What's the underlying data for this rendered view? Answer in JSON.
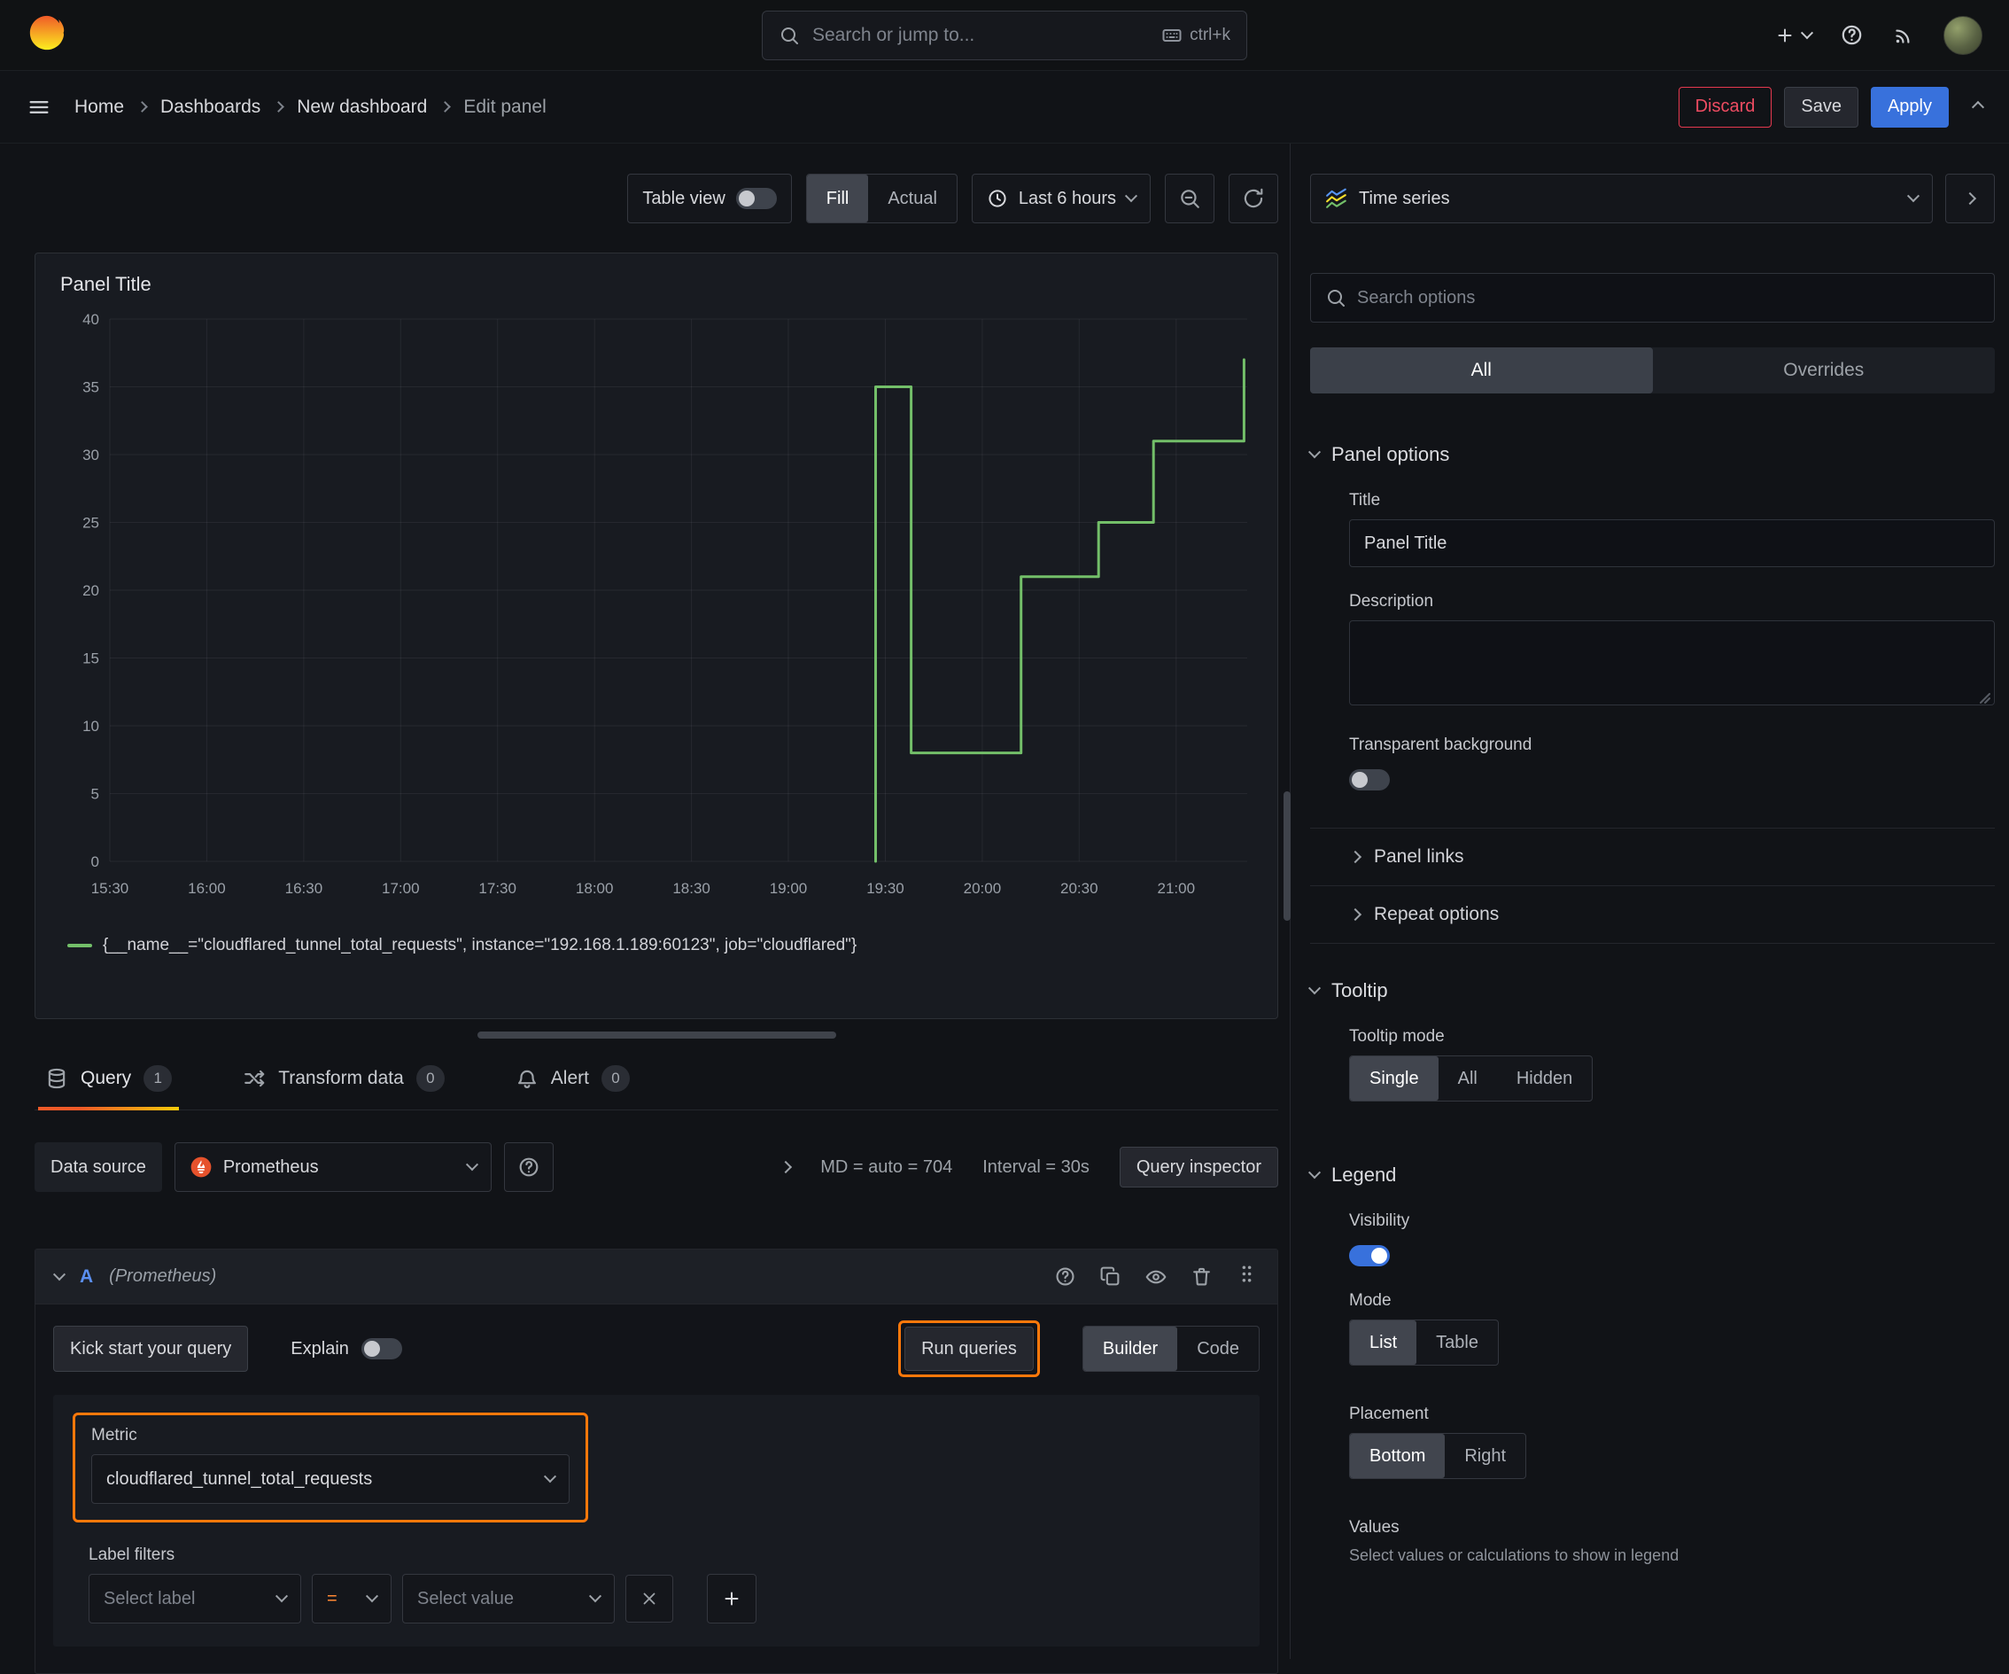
{
  "topbar": {
    "search": {
      "placeholder": "Search or jump to...",
      "shortcut": "ctrl+k"
    }
  },
  "breadcrumb": {
    "items": [
      "Home",
      "Dashboards",
      "New dashboard",
      "Edit panel"
    ],
    "actions": {
      "discard": "Discard",
      "save": "Save",
      "apply": "Apply"
    }
  },
  "toolbar": {
    "table_view": "Table view",
    "fill": "Fill",
    "actual": "Actual",
    "time_range": "Last 6 hours"
  },
  "panel": {
    "title": "Panel Title",
    "legend_label": "{__name__=\"cloudflared_tunnel_total_requests\", instance=\"192.168.1.189:60123\", job=\"cloudflared\"}"
  },
  "chart_data": {
    "type": "line",
    "line_style": "step-after",
    "title": "Panel Title",
    "x_ticks": [
      "15:30",
      "16:00",
      "16:30",
      "17:00",
      "17:30",
      "18:00",
      "18:30",
      "19:00",
      "19:30",
      "20:00",
      "20:30",
      "21:00"
    ],
    "x_range": [
      "15:30",
      "21:22"
    ],
    "y_ticks": [
      0,
      5,
      10,
      15,
      20,
      25,
      30,
      35,
      40
    ],
    "ylim": [
      0,
      40
    ],
    "grid": true,
    "legend_position": "bottom",
    "series": [
      {
        "name": "{__name__=\"cloudflared_tunnel_total_requests\", instance=\"192.168.1.189:60123\", job=\"cloudflared\"}",
        "color": "#73bf69",
        "points": [
          {
            "x": "19:27",
            "y": 0
          },
          {
            "x": "19:27",
            "y": 35
          },
          {
            "x": "19:38",
            "y": 35
          },
          {
            "x": "19:38",
            "y": 8
          },
          {
            "x": "20:12",
            "y": 8
          },
          {
            "x": "20:12",
            "y": 21
          },
          {
            "x": "20:36",
            "y": 21
          },
          {
            "x": "20:36",
            "y": 25
          },
          {
            "x": "20:53",
            "y": 25
          },
          {
            "x": "20:53",
            "y": 31
          },
          {
            "x": "21:21",
            "y": 31
          },
          {
            "x": "21:21",
            "y": 37
          }
        ]
      }
    ]
  },
  "query_section": {
    "tabs": [
      {
        "label": "Query",
        "count": "1"
      },
      {
        "label": "Transform data",
        "count": "0"
      },
      {
        "label": "Alert",
        "count": "0"
      }
    ],
    "datasource": {
      "label": "Data source",
      "value": "Prometheus",
      "max_data_points": "MD = auto = 704",
      "interval": "Interval = 30s",
      "inspector": "Query inspector"
    },
    "query": {
      "ref_id": "A",
      "ds_hint": "(Prometheus)",
      "kick_start": "Kick start your query",
      "explain": "Explain",
      "run_queries": "Run queries",
      "builder": "Builder",
      "code": "Code",
      "metric_label": "Metric",
      "metric_value": "cloudflared_tunnel_total_requests",
      "label_filters": "Label filters",
      "select_label": "Select label",
      "operator": "=",
      "select_value": "Select value"
    }
  },
  "options_pane": {
    "visualization": "Time series",
    "search_placeholder": "Search options",
    "tabs": [
      "All",
      "Overrides"
    ],
    "panel_options": {
      "header": "Panel options",
      "title_label": "Title",
      "title_value": "Panel Title",
      "description_label": "Description",
      "transparent_label": "Transparent background"
    },
    "collapsed_sections": [
      "Panel links",
      "Repeat options"
    ],
    "tooltip": {
      "header": "Tooltip",
      "mode_label": "Tooltip mode",
      "modes": [
        "Single",
        "All",
        "Hidden"
      ],
      "selected": "Single"
    },
    "legend": {
      "header": "Legend",
      "visibility_label": "Visibility",
      "mode_label": "Mode",
      "modes": [
        "List",
        "Table"
      ],
      "mode_selected": "List",
      "placement_label": "Placement",
      "placements": [
        "Bottom",
        "Right"
      ],
      "placement_selected": "Bottom",
      "values_label": "Values",
      "values_hint": "Select values or calculations to show in legend"
    }
  },
  "colors": {
    "accent_blue": "#3871dc",
    "annotation_orange": "#ff780a",
    "danger_red": "#e5394f",
    "series_green": "#73bf69",
    "tab_underline": "linear-gradient(90deg,#f05a28,#fbca0a)"
  }
}
